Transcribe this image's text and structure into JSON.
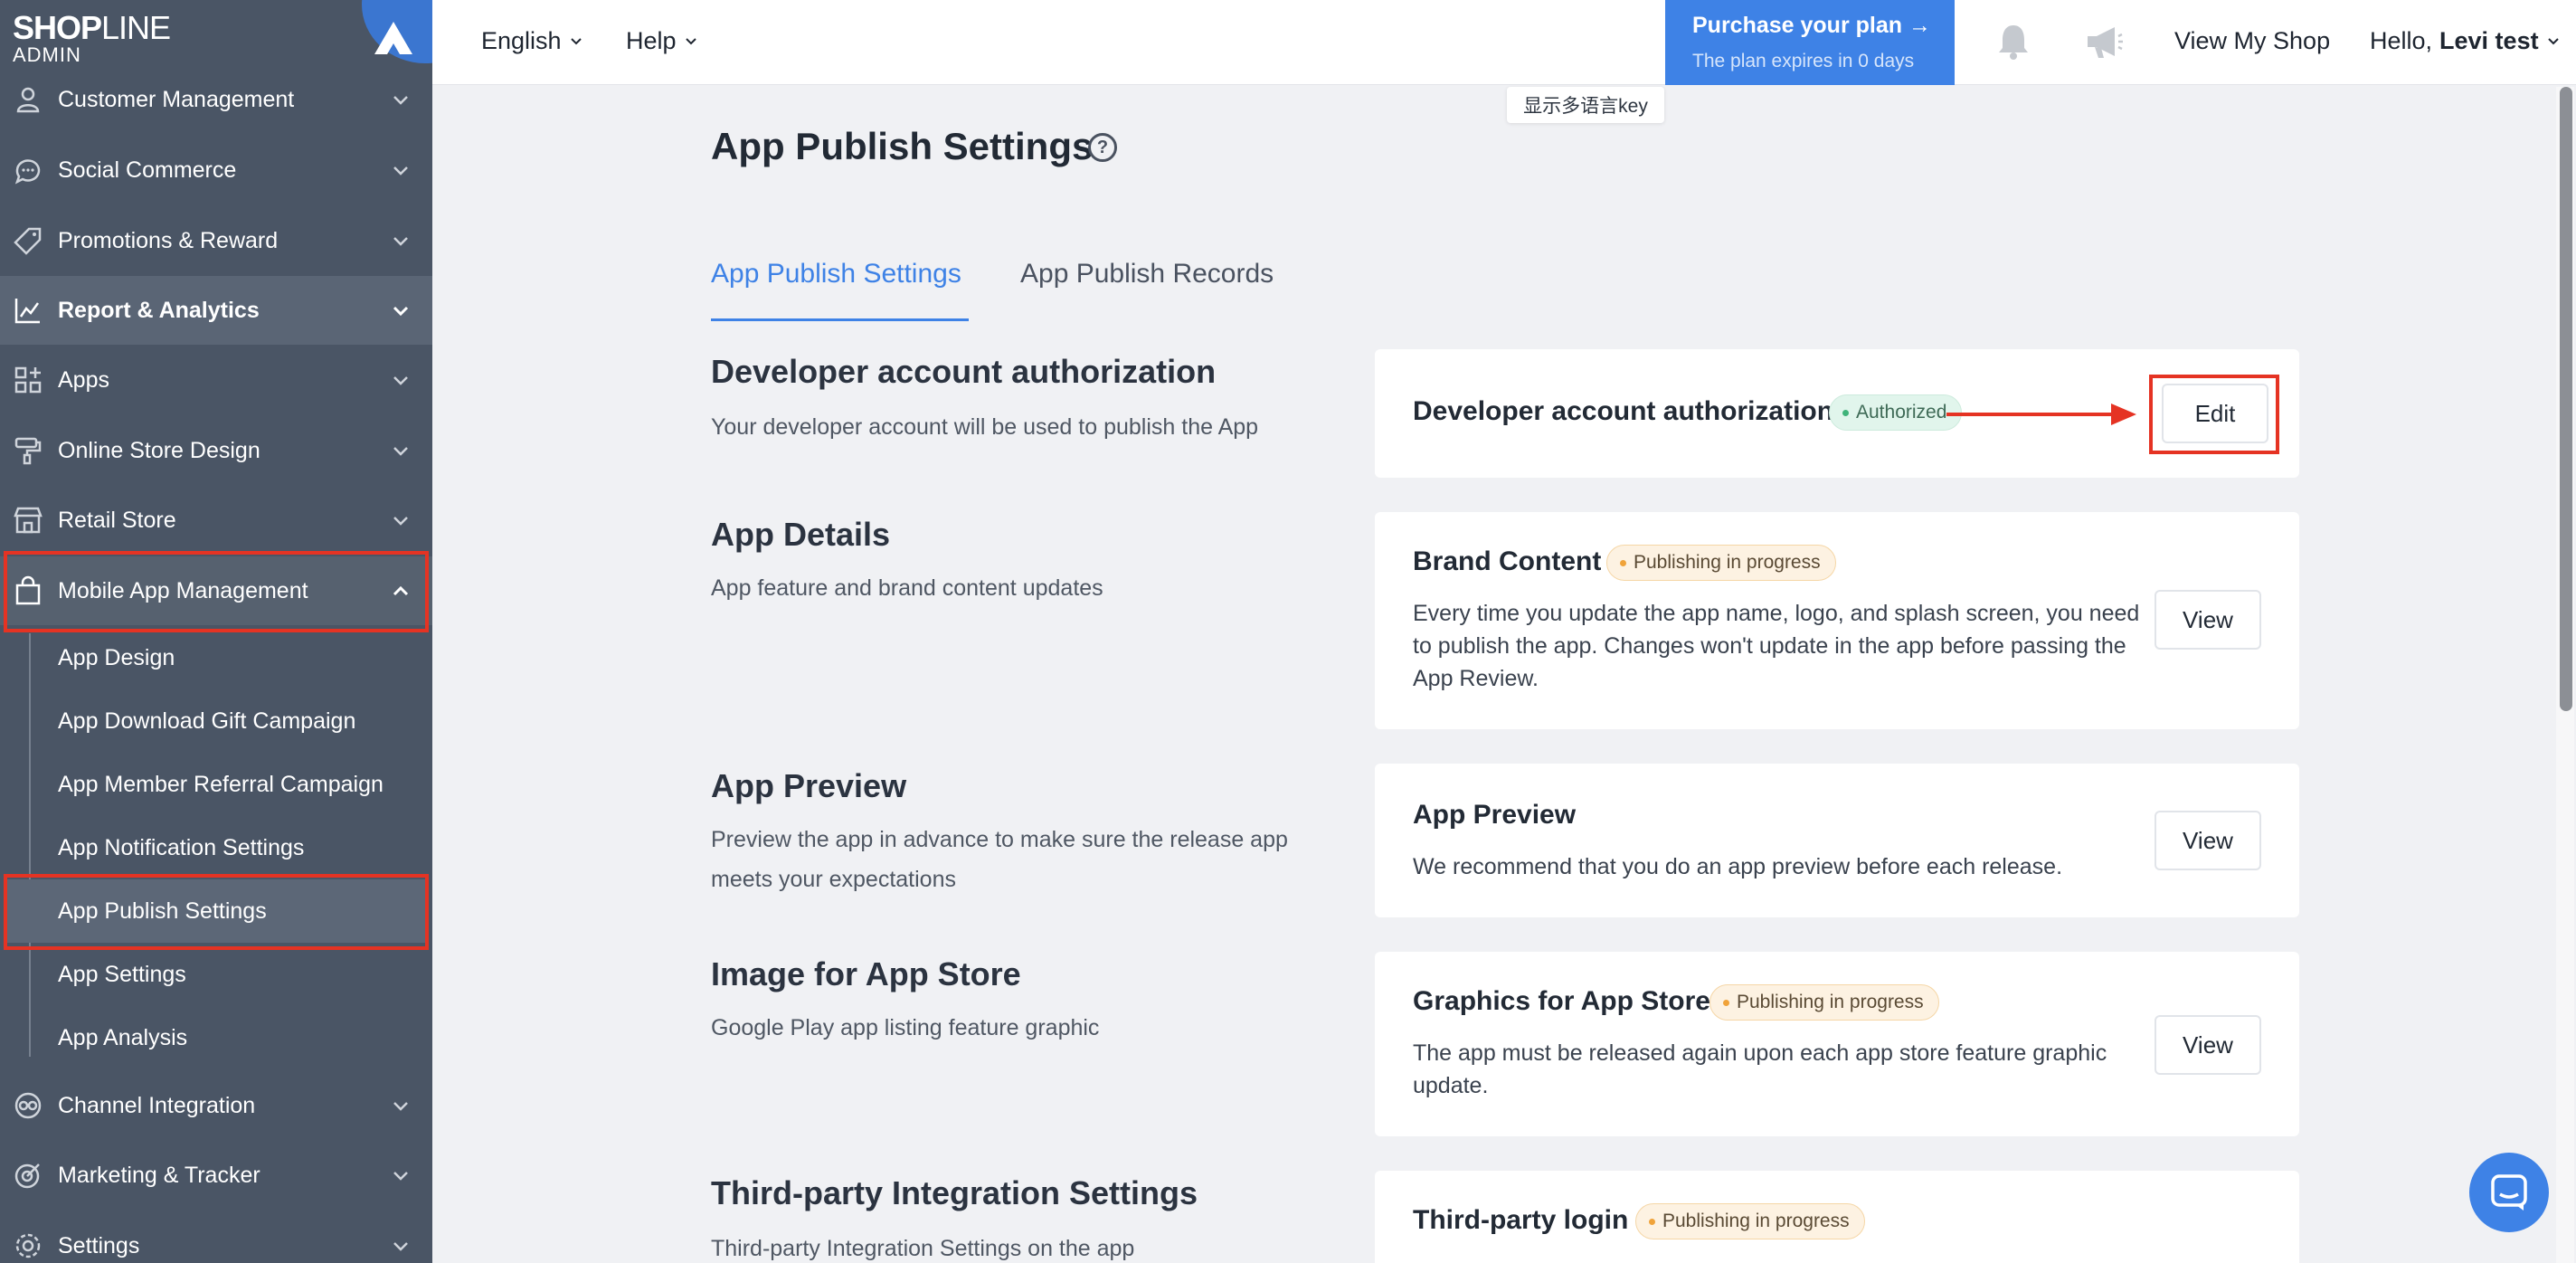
{
  "brand": {
    "name_bold": "SHOP",
    "name_thin": "LINE",
    "subtitle": "ADMIN",
    "accent": "#3e82e6"
  },
  "sidebar": {
    "items": [
      {
        "label": "Customer Management",
        "icon": "user-icon"
      },
      {
        "label": "Social Commerce",
        "icon": "chat-bubble-icon"
      },
      {
        "label": "Promotions & Reward",
        "icon": "tag-icon"
      },
      {
        "label": "Report & Analytics",
        "icon": "chart-icon"
      },
      {
        "label": "Apps",
        "icon": "apps-grid-icon"
      },
      {
        "label": "Online Store Design",
        "icon": "paint-roller-icon"
      },
      {
        "label": "Retail Store",
        "icon": "store-icon"
      },
      {
        "label": "Mobile App Management",
        "icon": "shopping-bag-icon"
      },
      {
        "label": "Channel Integration",
        "icon": "channel-icon"
      },
      {
        "label": "Marketing & Tracker",
        "icon": "target-icon"
      },
      {
        "label": "Settings",
        "icon": "gear-icon"
      }
    ],
    "sub_items": [
      {
        "label": "App Design"
      },
      {
        "label": "App Download Gift Campaign"
      },
      {
        "label": "App Member Referral Campaign"
      },
      {
        "label": "App Notification Settings"
      },
      {
        "label": "App Publish Settings",
        "selected": true
      },
      {
        "label": "App Settings"
      },
      {
        "label": "App Analysis"
      }
    ]
  },
  "topbar": {
    "language": "English",
    "help": "Help",
    "purchase_title": "Purchase your plan →",
    "purchase_sub": "The plan expires in 0 days",
    "view_shop": "View My Shop",
    "greeting": "Hello,",
    "user_name": "Levi test"
  },
  "tooltip": "显示多语言key",
  "page": {
    "title": "App Publish Settings",
    "tabs": [
      {
        "label": "App Publish Settings",
        "active": true
      },
      {
        "label": "App Publish Records",
        "active": false
      }
    ]
  },
  "sections": [
    {
      "title": "Developer account authorization",
      "desc": "Your developer account will be used to publish the App",
      "card_title": "Developer account authorization",
      "badge": "Authorized",
      "badge_type": "green",
      "card_desc": "",
      "button": "Edit"
    },
    {
      "title": "App Details",
      "desc": "App feature and brand content updates",
      "card_title": "Brand Content",
      "badge": "Publishing in progress",
      "badge_type": "orange",
      "card_desc": "Every time you update the app name, logo, and splash screen, you need to publish the app. Changes won't update in the app before passing the App Review.",
      "button": "View"
    },
    {
      "title": "App Preview",
      "desc": "Preview the app in advance to make sure the release app meets your expectations",
      "card_title": "App Preview",
      "badge": "",
      "card_desc": "We recommend that you do an app preview before each release.",
      "button": "View"
    },
    {
      "title": "Image for App Store",
      "desc": "Google Play app listing feature graphic",
      "card_title": "Graphics for App Store",
      "badge": "Publishing in progress",
      "badge_type": "orange",
      "card_desc": "The app must be released again upon each app store feature graphic update.",
      "button": "View"
    },
    {
      "title": "Third-party Integration Settings",
      "desc": "Third-party Integration Settings on the app",
      "card_title": "Third-party login",
      "badge": "Publishing in progress",
      "badge_type": "orange",
      "card_desc": "",
      "button": ""
    }
  ],
  "annotation_color": "#e53323"
}
